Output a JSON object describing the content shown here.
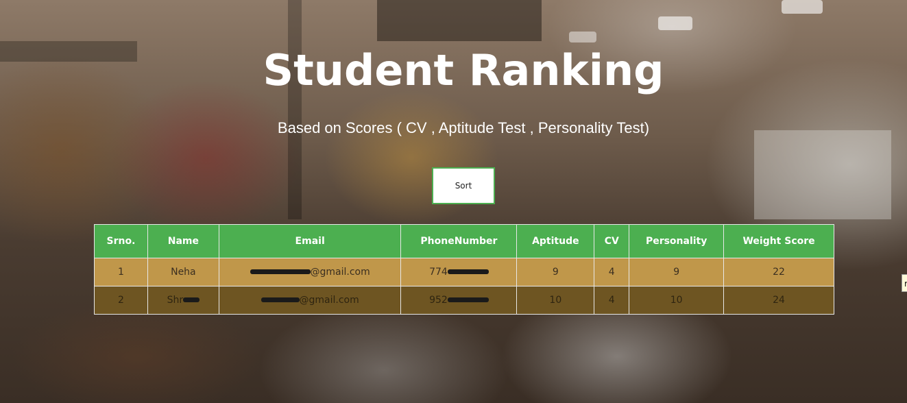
{
  "page": {
    "title": "Student Ranking",
    "subtitle": "Based on Scores ( CV , Aptitude Test , Personality Test)",
    "sort_label": "Sort",
    "edge_tab_text": "r"
  },
  "colors": {
    "header_green": "#4caf50",
    "row_odd": "#c0974a",
    "row_even": "#6e5522",
    "sort_border": "#4caf50"
  },
  "table": {
    "headers": [
      "Srno.",
      "Name",
      "Email",
      "PhoneNumber",
      "Aptitude",
      "CV",
      "Personality",
      "Weight Score"
    ],
    "rows": [
      {
        "srno": "1",
        "name": "Neha",
        "email_visible": "@gmail.com",
        "phone_visible": "774",
        "aptitude": "9",
        "cv": "4",
        "personality": "9",
        "weight_score": "22"
      },
      {
        "srno": "2",
        "name_visible": "Shr",
        "email_visible": "@gmail.com",
        "phone_visible": "952",
        "aptitude": "10",
        "cv": "4",
        "personality": "10",
        "weight_score": "24"
      }
    ]
  }
}
